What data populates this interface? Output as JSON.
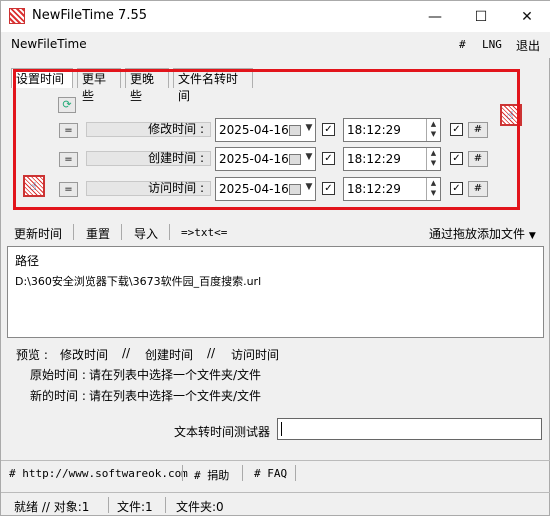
{
  "window": {
    "title": "NewFileTime 7.55",
    "minimize": "—",
    "maximize": "☐",
    "close": "✕"
  },
  "menu": {
    "title": "NewFileTime",
    "hash": "#",
    "lng": "LNG",
    "exit": "退出"
  },
  "tabs": [
    "设置时间",
    "更早些",
    "更晚些",
    "文件名转时间"
  ],
  "rows": [
    {
      "eq": "=",
      "label": "修改时间 :",
      "date": "2025-04-16",
      "time": "18:12:29",
      "hash": "#"
    },
    {
      "eq": "=",
      "label": "创建时间 :",
      "date": "2025-04-16",
      "time": "18:12:29",
      "hash": "#"
    },
    {
      "eq": "=",
      "label": "访问时间 :",
      "date": "2025-04-16",
      "time": "18:12:29",
      "hash": "#"
    }
  ],
  "toolbar": {
    "update": "更新时间",
    "reset": "重置",
    "import": "导入",
    "txt": "=>txt<=",
    "drag": "通过拖放添加文件"
  },
  "list": {
    "header": "路径",
    "items": [
      "D:\\360安全浏览器下载\\3673软件园_百度搜索.url"
    ]
  },
  "preview": {
    "title": "预览 :",
    "mod": "修改时间",
    "sep1": "//",
    "cre": "创建时间",
    "sep2": "//",
    "acc": "访问时间",
    "orig_label": "原始时间 :",
    "orig_val": "请在列表中选择一个文件夹/文件",
    "new_label": "新的时间 :",
    "new_val": "请在列表中选择一个文件夹/文件"
  },
  "tester": {
    "label": "文本转时间测试器"
  },
  "links": {
    "site": "# http://www.softwareok.com",
    "donate": "# 捐助",
    "faq": "# FAQ"
  },
  "status": {
    "ready": "就绪 // 对象:1",
    "files": "文件:1",
    "folders": "文件夹:0"
  }
}
